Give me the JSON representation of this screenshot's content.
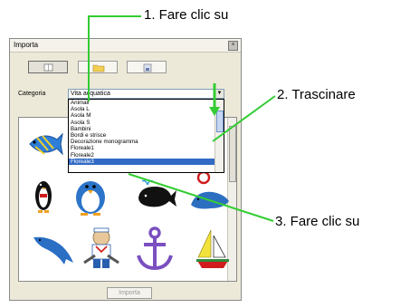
{
  "dialog": {
    "title": "Importa",
    "close_glyph": "×",
    "category_label": "Categoria",
    "category_value": "Vita acquatica",
    "import_button": "Importa"
  },
  "category_list": [
    "Animali",
    "Asola L",
    "Asola M",
    "Asola S",
    "Bambini",
    "Bordi e strisce",
    "Decorazione monogramma",
    "Floreale1",
    "Floreale2",
    "Floreale3"
  ],
  "selected_item": "Floreale3",
  "callouts": {
    "step1": "1. Fare clic su",
    "step2": "2. Trascinare",
    "step3": "3. Fare clic su"
  },
  "colors": {
    "callout_line": "#33cc33",
    "selection": "#316ac5"
  },
  "thumbnails": [
    "fish-icon",
    "penguin-icon",
    "penguin-icon",
    "whale-icon",
    "seal-icon",
    "dolphin-icon",
    "dolphin-icon",
    "sailor-bear-icon",
    "anchor-icon",
    "sailboat-icon"
  ]
}
